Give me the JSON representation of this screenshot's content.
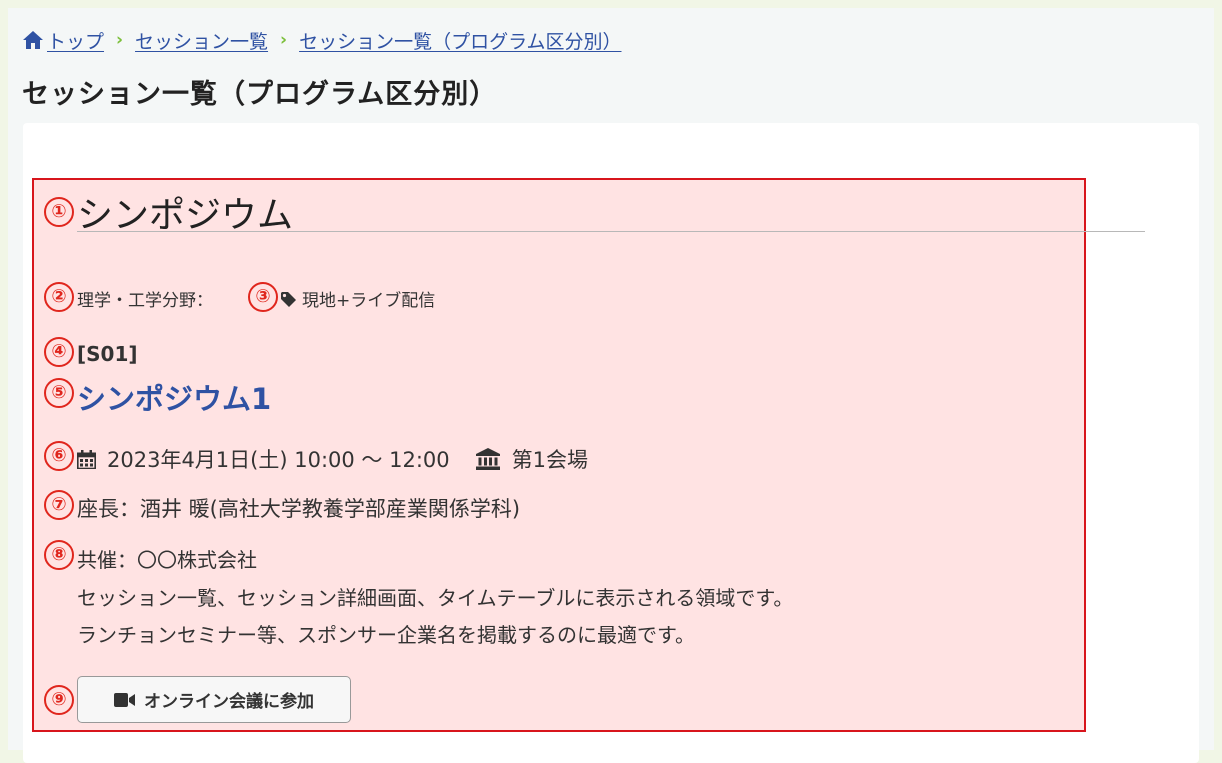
{
  "breadcrumb": {
    "home": "トップ",
    "level1": "セッション一覧",
    "level2": "セッション一覧（プログラム区分別）"
  },
  "page": {
    "title": "セッション一覧（プログラム区分別）"
  },
  "callouts": [
    "①",
    "②",
    "③",
    "④",
    "⑤",
    "⑥",
    "⑦",
    "⑧",
    "⑨"
  ],
  "session": {
    "program_type": "シンポジウム",
    "field": "理学・工学分野：",
    "tag": "現地+ライブ配信",
    "code": "[S01]",
    "title": "シンポジウム1",
    "datetime": "2023年4月1日(土) 10:00 〜 12:00",
    "venue": "第1会場",
    "chair": "座長：酒井 暖(高社大学教養学部産業関係学科)",
    "cosponsor": "共催：〇〇株式会社",
    "desc_line1": "セッション一覧、セッション詳細画面、タイムテーブルに表示される領域です。",
    "desc_line2": "ランチョンセミナー等、スポンサー企業名を掲載するのに最適です。",
    "join_button": "オンライン会議に参加"
  },
  "colors": {
    "link": "#2f52a3",
    "callout": "#e0261d",
    "highlight_bg": "#ffe3e3",
    "highlight_border": "#d8151c",
    "separator": "#7bbf3a"
  },
  "icons": [
    "home-icon",
    "chevron-right-icon",
    "tag-icon",
    "calendar-icon",
    "building-icon",
    "video-icon"
  ]
}
